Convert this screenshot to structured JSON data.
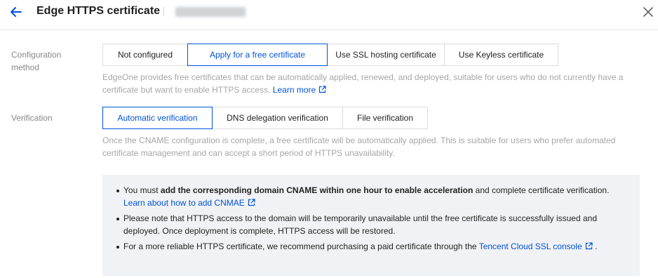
{
  "header": {
    "title": "Edge HTTPS certificate"
  },
  "config": {
    "label_line1": "Configuration",
    "label_line2": "method",
    "options": [
      "Not configured",
      "Apply for a free certificate",
      "Use SSL hosting certificate",
      "Use Keyless certificate"
    ],
    "selected": "Apply for a free certificate",
    "desc": "EdgeOne provides free certificates that can be automatically applied, renewed, and deployed, suitable for users who do not currently have a certificate but want to enable HTTPS access.",
    "learn_more": "Learn more"
  },
  "verification": {
    "label": "Verification",
    "options": [
      "Automatic verification",
      "DNS delegation verification",
      "File verification"
    ],
    "selected": "Automatic verification",
    "desc": "Once the CNAME configuration is complete, a free certificate will be automatically applied. This is suitable for users who prefer automated certificate management and can accept a short period of HTTPS unavailability."
  },
  "notice": {
    "item1_prefix": "You must ",
    "item1_bold": "add the corresponding domain CNAME within one hour to enable acceleration",
    "item1_suffix": " and complete certificate verification.",
    "item1_link": "Learn about how to add CNMAE",
    "item2": "Please note that HTTPS access to the domain will be temporarily unavailable until the free certificate is successfully issued and deployed. Once deployment is complete, HTTPS access will be restored.",
    "item3_prefix": "For a more reliable HTTPS certificate, we recommend purchasing a paid certificate through the ",
    "item3_link": "Tencent Cloud SSL console",
    "item3_suffix": " ."
  },
  "colors": {
    "accent": "#0052d9",
    "notice_bg": "#f1f2f5"
  },
  "icons": [
    "arrow-left-icon",
    "close-icon",
    "external-link-icon"
  ]
}
